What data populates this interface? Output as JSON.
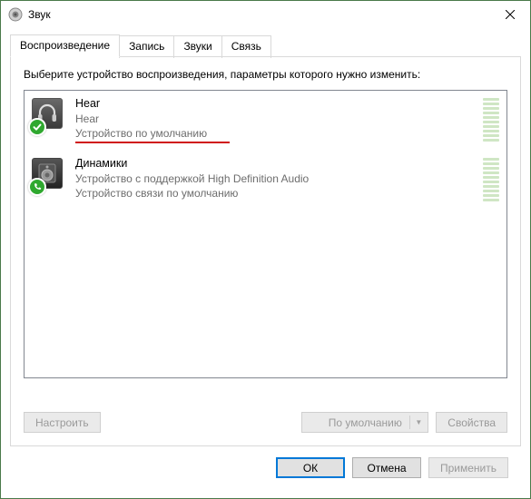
{
  "window": {
    "title": "Звук"
  },
  "tabs": [
    {
      "label": "Воспроизведение",
      "active": true
    },
    {
      "label": "Запись",
      "active": false
    },
    {
      "label": "Звуки",
      "active": false
    },
    {
      "label": "Связь",
      "active": false
    }
  ],
  "instruction": "Выберите устройство воспроизведения, параметры которого нужно изменить:",
  "devices": [
    {
      "name": "Hear",
      "sub": "Hear",
      "status": "Устройство по умолчанию",
      "icon": "headphones-icon",
      "badge": "check-badge",
      "underline": true
    },
    {
      "name": "Динамики",
      "sub": "Устройство с поддержкой High Definition Audio",
      "status": "Устройство связи по умолчанию",
      "icon": "speaker-icon",
      "badge": "phone-badge",
      "underline": false
    }
  ],
  "buttons": {
    "configure": "Настроить",
    "default_dropdown": "По умолчанию",
    "properties": "Свойства",
    "ok": "ОК",
    "cancel": "Отмена",
    "apply": "Применить"
  }
}
